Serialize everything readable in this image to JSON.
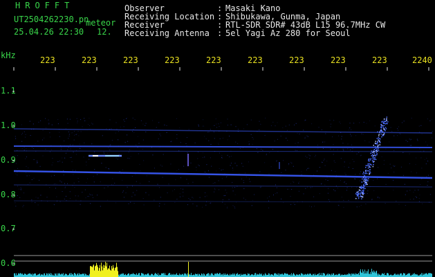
{
  "header": {
    "title": "HROFFT",
    "filename": "UT2504262230.pn",
    "meteor_label": "meteor",
    "datetime": "25.04.26 22:30",
    "count": "12.",
    "fields": [
      {
        "label": "Observer",
        "value": "Masaki Kano"
      },
      {
        "label": "Receiving Location",
        "value": "Shibukawa, Gunma, Japan"
      },
      {
        "label": "Receiver",
        "value": "RTL-SDR SDR# 43dB L15 96.7MHz CW"
      },
      {
        "label": "Receiving Antenna",
        "value": "5el Yagi Az 280 for Seoul"
      }
    ],
    "separator": ":"
  },
  "time_axis": {
    "labels": [
      "223",
      "223",
      "223",
      "223",
      "223",
      "223",
      "223",
      "223",
      "223",
      "2240"
    ],
    "color": "#e8e020"
  },
  "freq_axis": {
    "unit": "kHz",
    "labels": [
      "1.1",
      "1.0",
      "0.9",
      "0.8",
      "0.7",
      "0.6"
    ],
    "values": [
      1.1,
      1.0,
      0.9,
      0.8,
      0.7,
      0.6
    ]
  },
  "colors": {
    "background": "#000000",
    "text_green": "#39d64a",
    "text_white": "#e8e8e8",
    "signal_blue": "#3b5cff",
    "level_cyan": "#2fc4d8",
    "level_yellow": "#f0f020"
  }
}
